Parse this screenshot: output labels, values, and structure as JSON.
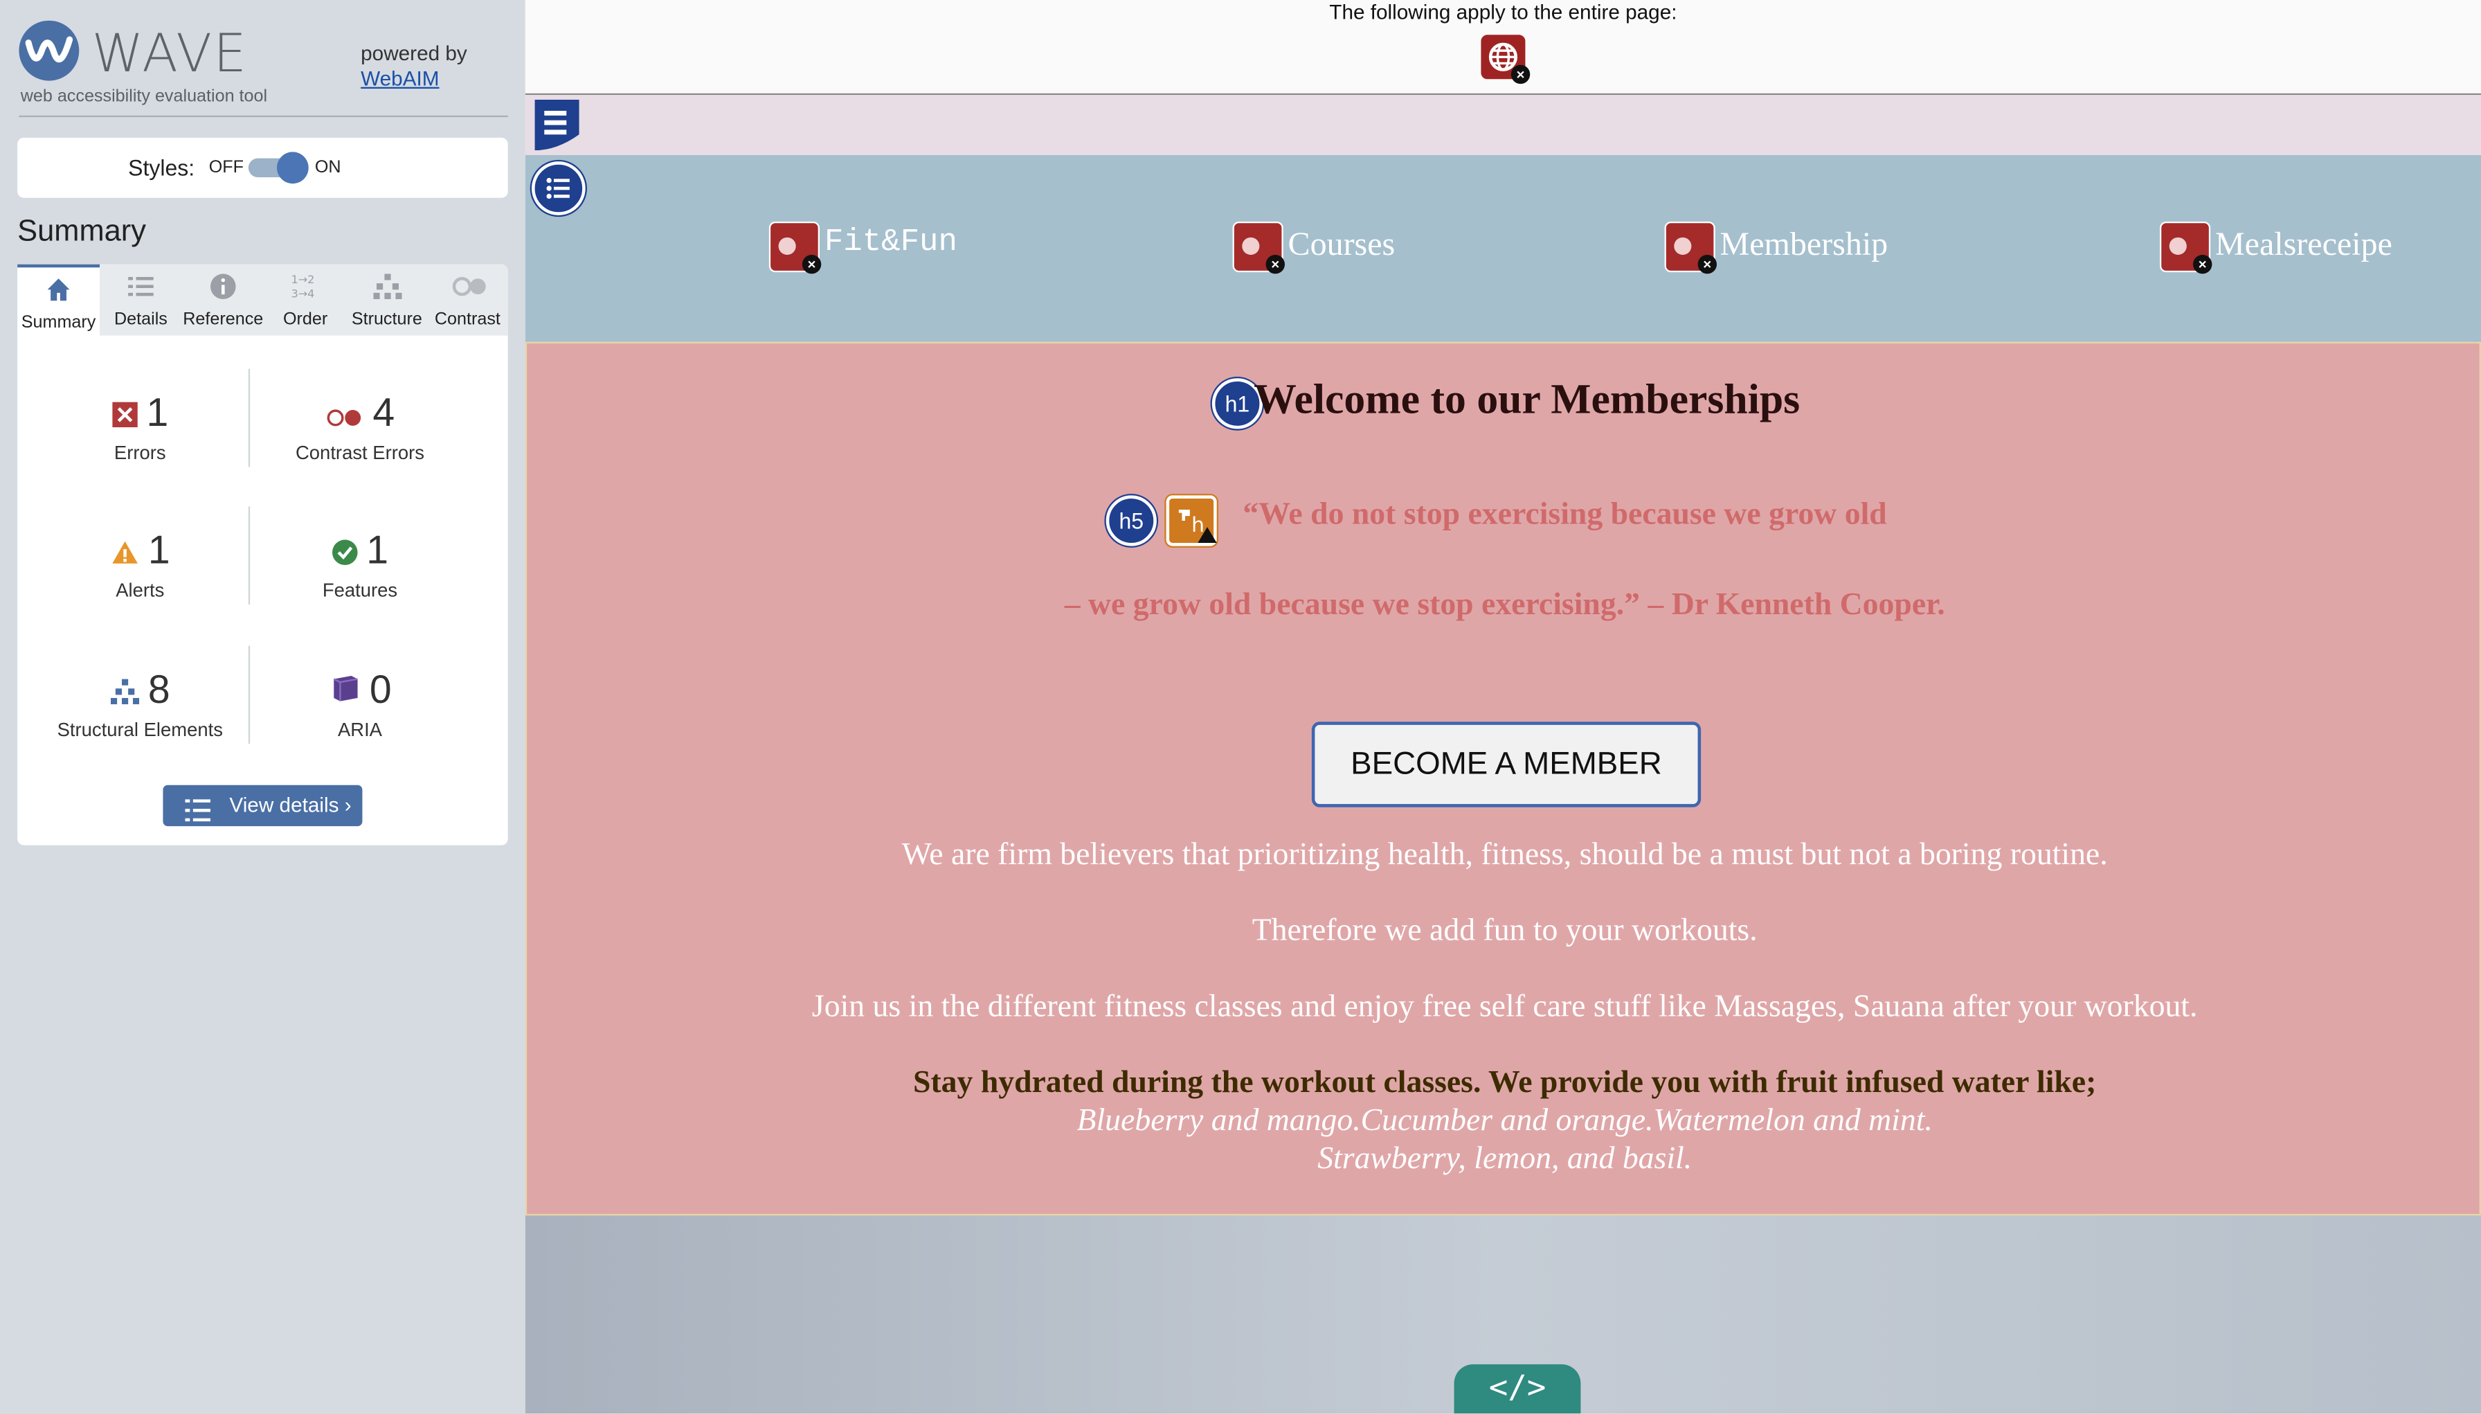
{
  "wave": {
    "logo_word": "WAVE",
    "tagline": "web accessibility evaluation tool",
    "powered_by": "powered by",
    "webaim_link": "WebAIM",
    "styles_label": "Styles:",
    "styles_off": "OFF",
    "styles_on": "ON",
    "summary_title": "Summary",
    "tabs": [
      {
        "label": "Summary",
        "icon": "home-icon"
      },
      {
        "label": "Details",
        "icon": "list-icon"
      },
      {
        "label": "Reference",
        "icon": "info-icon"
      },
      {
        "label": "Order",
        "icon": "order-icon"
      },
      {
        "label": "Structure",
        "icon": "structure-icon"
      },
      {
        "label": "Contrast",
        "icon": "contrast-icon"
      }
    ],
    "stats": {
      "errors": {
        "count": "1",
        "label": "Errors",
        "color": "#b03a3a"
      },
      "contrast_errors": {
        "count": "4",
        "label": "Contrast Errors",
        "color": "#b03a3a"
      },
      "alerts": {
        "count": "1",
        "label": "Alerts",
        "color": "#e8952a"
      },
      "features": {
        "count": "1",
        "label": "Features",
        "color": "#3b8a4a"
      },
      "structural": {
        "count": "8",
        "label": "Structural Elements",
        "color": "#4a6fa5"
      },
      "aria": {
        "count": "0",
        "label": "ARIA",
        "color": "#5b3f8f"
      }
    },
    "view_details": "View details ›"
  },
  "page": {
    "notice": "The following apply to the entire page:",
    "nav": [
      "Fit&Fun",
      "Courses",
      "Membership",
      "Mealsreceipe"
    ],
    "h1": "Welcome to our Memberships",
    "h1_badge": "h1",
    "h5_badge": "h5",
    "quote_line1": "“We do not stop exercising because we grow old",
    "quote_line2": "– we grow old because we stop exercising.” – Dr Kenneth Cooper.",
    "cta": "BECOME A MEMBER",
    "para1": "We are firm believers that prioritizing health, fitness, should be a must but not a boring routine.",
    "para2": "Therefore we add fun to your workouts.",
    "para3": "Join us in the different fitness classes and enjoy free self care stuff like Massages, Sauana after your workout.",
    "para4": "Stay hydrated during the workout classes. We provide you with fruit infused water like;",
    "para5": "Blueberry and mango.Cucumber and orange.Watermelon and mint.",
    "para6": "Strawberry, lemon, and basil.",
    "code_badge": "</>"
  },
  "colors": {
    "wave_blue": "#4a6fa5",
    "hero_pink": "#dfa6a8",
    "nav_blue": "#a5bfcd"
  }
}
